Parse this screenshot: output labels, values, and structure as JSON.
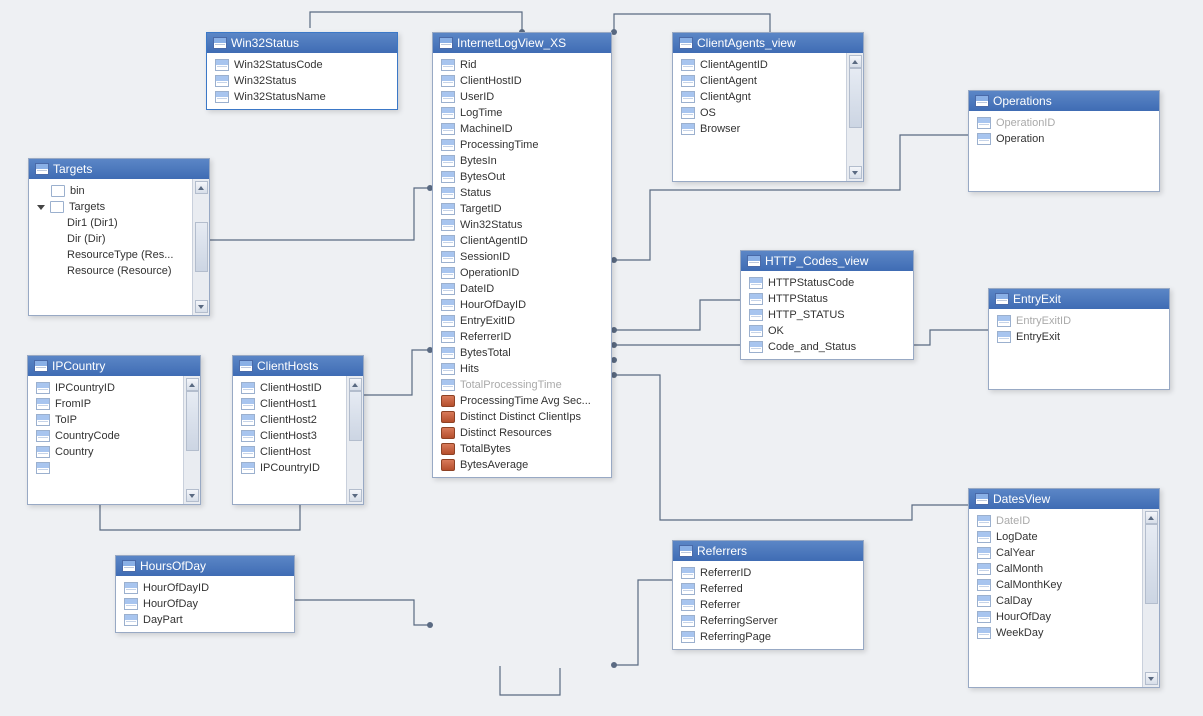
{
  "tables": {
    "win32status": {
      "title": "Win32Status",
      "cols": [
        {
          "n": "Win32StatusCode",
          "t": "col"
        },
        {
          "n": "Win32Status",
          "t": "col"
        },
        {
          "n": "Win32StatusName",
          "t": "col"
        }
      ]
    },
    "internetlog": {
      "title": "InternetLogView_XS",
      "cols": [
        {
          "n": "Rid",
          "t": "col"
        },
        {
          "n": "ClientHostID",
          "t": "col"
        },
        {
          "n": "UserID",
          "t": "col"
        },
        {
          "n": "LogTime",
          "t": "col"
        },
        {
          "n": "MachineID",
          "t": "col"
        },
        {
          "n": "ProcessingTime",
          "t": "col"
        },
        {
          "n": "BytesIn",
          "t": "col"
        },
        {
          "n": "BytesOut",
          "t": "col"
        },
        {
          "n": "Status",
          "t": "col"
        },
        {
          "n": "TargetID",
          "t": "col"
        },
        {
          "n": "Win32Status",
          "t": "col"
        },
        {
          "n": "ClientAgentID",
          "t": "col"
        },
        {
          "n": "SessionID",
          "t": "col"
        },
        {
          "n": "OperationID",
          "t": "col"
        },
        {
          "n": "DateID",
          "t": "col"
        },
        {
          "n": "HourOfDayID",
          "t": "col"
        },
        {
          "n": "EntryExitID",
          "t": "col"
        },
        {
          "n": "ReferrerID",
          "t": "col"
        },
        {
          "n": "BytesTotal",
          "t": "col"
        },
        {
          "n": "Hits",
          "t": "col"
        },
        {
          "n": "TotalProcessingTime",
          "t": "col",
          "dim": true
        },
        {
          "n": "ProcessingTime Avg Sec...",
          "t": "calc"
        },
        {
          "n": "Distinct Distinct ClientIps",
          "t": "calc"
        },
        {
          "n": "Distinct Resources",
          "t": "calc"
        },
        {
          "n": "TotalBytes",
          "t": "calc"
        },
        {
          "n": "BytesAverage",
          "t": "calc"
        }
      ]
    },
    "clientagents": {
      "title": "ClientAgents_view",
      "cols": [
        {
          "n": "ClientAgentID",
          "t": "col"
        },
        {
          "n": "ClientAgent",
          "t": "col"
        },
        {
          "n": "ClientAgnt",
          "t": "col"
        },
        {
          "n": "OS",
          "t": "col"
        },
        {
          "n": "Browser",
          "t": "col"
        }
      ]
    },
    "operations": {
      "title": "Operations",
      "cols": [
        {
          "n": "OperationID",
          "t": "col",
          "dim": true
        },
        {
          "n": "Operation",
          "t": "col"
        }
      ]
    },
    "targets": {
      "title": "Targets",
      "tree": [
        {
          "n": "bin",
          "indent": 1,
          "t": "tree"
        },
        {
          "n": "Targets",
          "indent": 0,
          "arrow": "down",
          "t": "tree"
        },
        {
          "n": "Dir1 (Dir1)",
          "indent": 2
        },
        {
          "n": "Dir (Dir)",
          "indent": 2
        },
        {
          "n": "ResourceType (Res...",
          "indent": 2
        },
        {
          "n": "Resource (Resource)",
          "indent": 2
        }
      ]
    },
    "ipcountry": {
      "title": "IPCountry",
      "cols": [
        {
          "n": "IPCountryID",
          "t": "col"
        },
        {
          "n": "FromIP",
          "t": "col"
        },
        {
          "n": "ToIP",
          "t": "col"
        },
        {
          "n": "CountryCode",
          "t": "col"
        },
        {
          "n": "Country",
          "t": "col"
        },
        {
          "n": "",
          "t": "col"
        }
      ]
    },
    "clienthosts": {
      "title": "ClientHosts",
      "cols": [
        {
          "n": "ClientHostID",
          "t": "col"
        },
        {
          "n": "ClientHost1",
          "t": "col"
        },
        {
          "n": "ClientHost2",
          "t": "col"
        },
        {
          "n": "ClientHost3",
          "t": "col"
        },
        {
          "n": "ClientHost",
          "t": "col"
        },
        {
          "n": "IPCountryID",
          "t": "col"
        }
      ]
    },
    "httpcodes": {
      "title": "HTTP_Codes_view",
      "cols": [
        {
          "n": "HTTPStatusCode",
          "t": "col"
        },
        {
          "n": "HTTPStatus",
          "t": "col"
        },
        {
          "n": "HTTP_STATUS",
          "t": "col"
        },
        {
          "n": "OK",
          "t": "col"
        },
        {
          "n": "Code_and_Status",
          "t": "col"
        }
      ]
    },
    "entryexit": {
      "title": "EntryExit",
      "cols": [
        {
          "n": "EntryExitID",
          "t": "col",
          "dim": true
        },
        {
          "n": "EntryExit",
          "t": "col"
        }
      ]
    },
    "hoursofday": {
      "title": "HoursOfDay",
      "cols": [
        {
          "n": "HourOfDayID",
          "t": "col"
        },
        {
          "n": "HourOfDay",
          "t": "col"
        },
        {
          "n": "DayPart",
          "t": "col"
        }
      ]
    },
    "referrers": {
      "title": "Referrers",
      "cols": [
        {
          "n": "ReferrerID",
          "t": "col"
        },
        {
          "n": "Referred",
          "t": "col"
        },
        {
          "n": "Referrer",
          "t": "col"
        },
        {
          "n": "ReferringServer",
          "t": "col"
        },
        {
          "n": "ReferringPage",
          "t": "col"
        }
      ]
    },
    "datesview": {
      "title": "DatesView",
      "cols": [
        {
          "n": "DateID",
          "t": "col",
          "dim": true
        },
        {
          "n": "LogDate",
          "t": "col"
        },
        {
          "n": "CalYear",
          "t": "col"
        },
        {
          "n": "CalMonth",
          "t": "col"
        },
        {
          "n": "CalMonthKey",
          "t": "col"
        },
        {
          "n": "CalDay",
          "t": "col"
        },
        {
          "n": "HourOfDay",
          "t": "col"
        },
        {
          "n": "WeekDay",
          "t": "col"
        }
      ]
    }
  }
}
